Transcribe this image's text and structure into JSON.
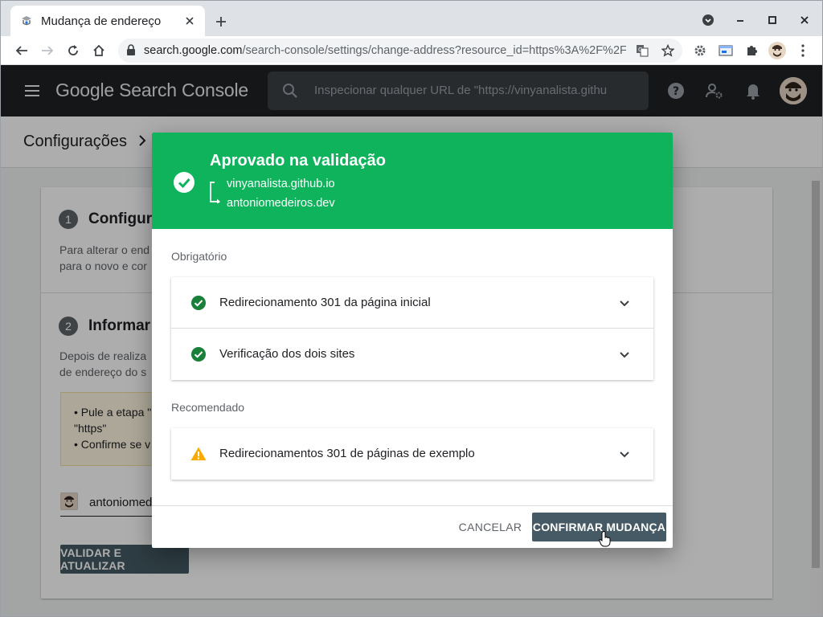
{
  "browser": {
    "tab_title": "Mudança de endereço",
    "url_host": "search.google.com",
    "url_path": "/search-console/settings/change-address?resource_id=https%3A%2F%2F…"
  },
  "appbar": {
    "product_name": "Google Search Console",
    "search_placeholder": "Inspecionar qualquer URL de \"https://vinyanalista.githu"
  },
  "breadcrumb": {
    "label": "Configurações"
  },
  "background_card": {
    "step1_number": "1",
    "step1_title": "Configura",
    "step1_text_line1": "Para alterar o end",
    "step1_text_line2": "para o novo e cor",
    "step2_number": "2",
    "step2_title": "Informar",
    "step2_text_line1": "Depois de realiza",
    "step2_text_line2": "de endereço do s",
    "tip_line1": "• Pule a etapa \"",
    "tip_line2": "\"https\"",
    "tip_line3": "• Confirme se v",
    "property_text": "antoniomed",
    "validate_button": "VALIDAR E ATUALIZAR"
  },
  "dialog": {
    "title": "Aprovado na validação",
    "from_site": "vinyanalista.github.io",
    "to_site": "antoniomedeiros.dev",
    "required_label": "Obrigatório",
    "required_items": [
      {
        "label": "Redirecionamento 301 da página inicial",
        "status": "pass"
      },
      {
        "label": "Verificação dos dois sites",
        "status": "pass"
      }
    ],
    "recommended_label": "Recomendado",
    "recommended_items": [
      {
        "label": "Redirecionamentos 301 de páginas de exemplo",
        "status": "warning"
      }
    ],
    "cancel_label": "CANCELAR",
    "confirm_label": "CONFIRMAR MUDANÇA"
  },
  "colors": {
    "success_green": "#0fb35c",
    "check_green": "#188038",
    "warning_amber": "#f9ab00",
    "button_slate": "#455a64",
    "appbar_dark": "#202124"
  }
}
